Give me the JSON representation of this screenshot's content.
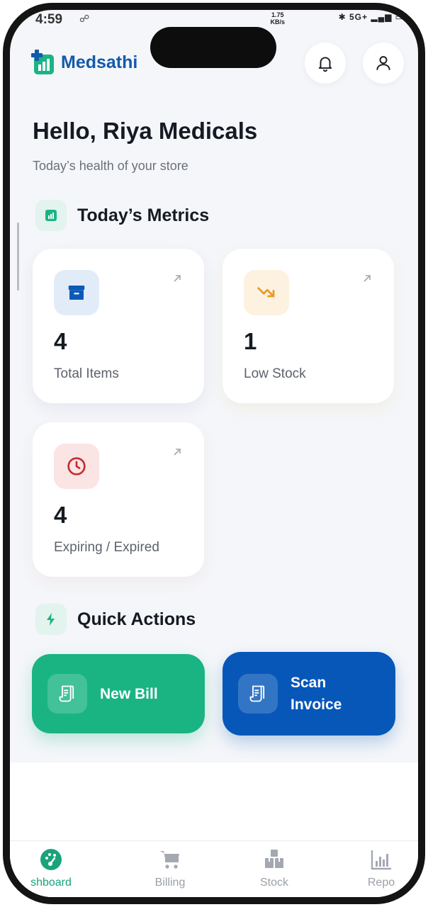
{
  "status_bar": {
    "time": "4:59",
    "network_speed_value": "1.75",
    "network_speed_unit": "KB/s",
    "network_type": "5G+"
  },
  "app": {
    "name": "Medsathi",
    "brand_color": "#1459ac",
    "accent_color": "#1ab483"
  },
  "header": {
    "greeting": "Hello, Riya Medicals",
    "subtitle": "Today’s health of your store"
  },
  "metrics": {
    "section_title": "Today’s Metrics",
    "cards": [
      {
        "value": "4",
        "label": "Total Items",
        "icon": "archive-box-icon",
        "color": "#0d59b8"
      },
      {
        "value": "1",
        "label": "Low Stock",
        "icon": "trending-down-icon",
        "color": "#e89b2a"
      },
      {
        "value": "4",
        "label": "Expiring / Expired",
        "icon": "clock-icon",
        "color": "#c42e2e"
      }
    ]
  },
  "quick_actions": {
    "section_title": "Quick Actions",
    "new_bill": {
      "label": "New Bill",
      "icon": "receipt-icon"
    },
    "scan_invoice": {
      "label_line1": "Scan",
      "label_line2": "Invoice",
      "icon": "receipt-icon"
    }
  },
  "bottom_nav": {
    "active_index": 0,
    "items": [
      {
        "label": "shboard",
        "icon": "dashboard-icon"
      },
      {
        "label": "Billing",
        "icon": "cart-icon"
      },
      {
        "label": "Stock",
        "icon": "boxes-icon"
      },
      {
        "label": "Repo",
        "icon": "bar-chart-icon"
      }
    ]
  }
}
